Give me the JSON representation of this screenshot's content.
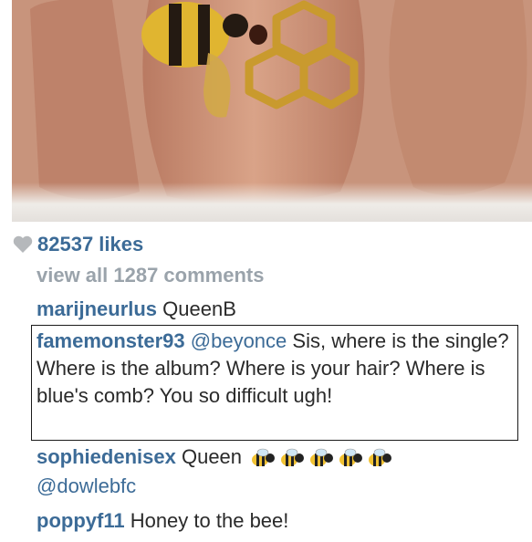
{
  "post": {
    "likes_icon": "heart-icon",
    "likes": "82537 likes",
    "view_all": "view all 1287 comments"
  },
  "comments": [
    {
      "user": "marijneurlus",
      "text": "QueenB"
    },
    {
      "user": "famemonster93",
      "mention": "@beyonce",
      "text": "Sis, where is the single? Where is the album? Where is your hair? Where is blue's comb? You so difficult ugh!"
    },
    {
      "user": "sophiedenisex",
      "text": "Queen",
      "emoji": "bee-emoji",
      "emoji_count": 5,
      "line2": "@dowlebfc"
    },
    {
      "user": "poppyf11",
      "text": "Honey to the bee!"
    }
  ],
  "colors": {
    "username": "#3c6b97",
    "muted": "#9aa3ab",
    "text": "#2a2a2a"
  }
}
